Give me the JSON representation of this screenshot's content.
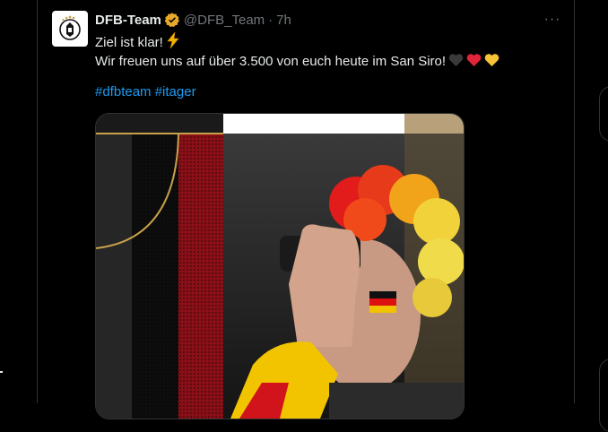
{
  "tweet": {
    "display_name": "DFB-Team",
    "handle": "@DFB_Team",
    "separator": "·",
    "time": "7h",
    "more_label": "···",
    "line1": "Ziel ist klar!",
    "line2": "Wir freuen uns auf über 3.500 von euch heute im San Siro!",
    "hashtag1": "#dfbteam",
    "hashtag2": "#itager"
  },
  "colors": {
    "accent": "#1d9bf0",
    "verified": "#e8a829",
    "muted": "#71767b"
  },
  "icons": [
    "dfb-logo-icon",
    "verified-badge-icon",
    "more-icon",
    "lightning-emoji-icon",
    "black-heart-icon",
    "red-heart-icon",
    "yellow-heart-icon"
  ]
}
